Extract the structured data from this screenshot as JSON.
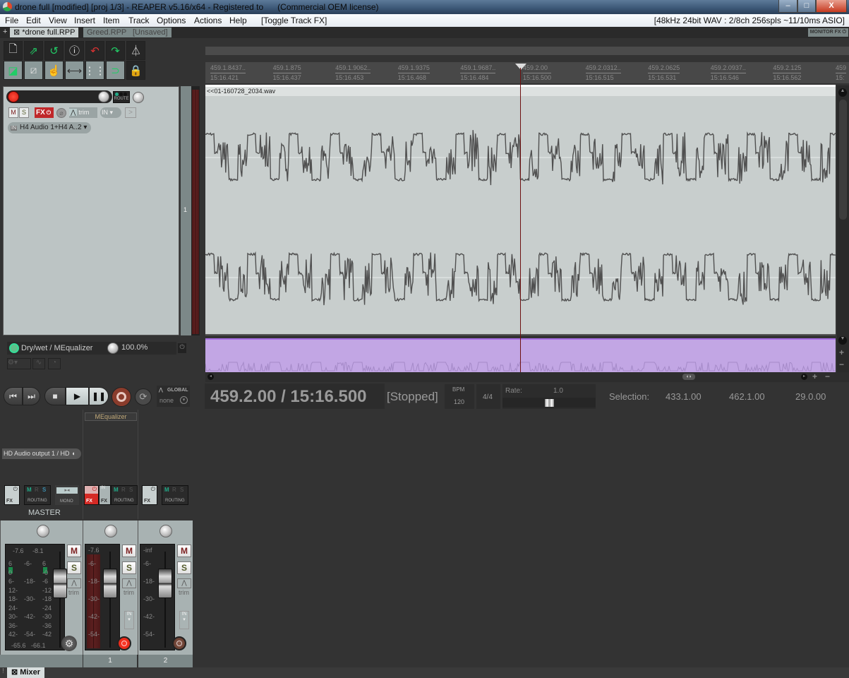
{
  "window": {
    "title": "drone full [modified] [proj 1/3] - REAPER v5.16/x64 - Registered to      (Commercial OEM license)",
    "minimize_label": "–",
    "maximize_label": "□",
    "close_label": "X"
  },
  "menu": {
    "items": [
      "File",
      "Edit",
      "View",
      "Insert",
      "Item",
      "Track",
      "Options",
      "Actions",
      "Help",
      "[Toggle Track FX]"
    ],
    "status": "[48kHz 24bit WAV : 2/8ch 256spls ~11/10ms ASIO]"
  },
  "project_tabs": {
    "add_label": "+",
    "tabs": [
      {
        "label": "⊠ *drone full.RPP",
        "active": true
      },
      {
        "label": "Greed.RPP",
        "active": false
      },
      {
        "label": "[Unsaved]",
        "active": false
      }
    ],
    "monitor_fx_label": "MONITOR FX ⏻"
  },
  "toolbar": {
    "buttons": [
      {
        "icon": "new-project-icon",
        "glyph": "🗋"
      },
      {
        "icon": "save-project-icon",
        "glyph": "⇗"
      },
      {
        "icon": "revert-project-icon",
        "glyph": "↺"
      },
      {
        "icon": "project-info-icon",
        "glyph": "ⓘ"
      },
      {
        "icon": "undo-icon",
        "glyph": "↶"
      },
      {
        "icon": "redo-icon",
        "glyph": "↷"
      },
      {
        "icon": "metronome-icon",
        "glyph": "⏃"
      },
      {
        "icon": "snap-icon",
        "glyph": "◪"
      },
      {
        "icon": "ripple-edit-icon",
        "glyph": "⧄"
      },
      {
        "icon": "grouping-icon",
        "glyph": "☝"
      },
      {
        "icon": "envelope-points-icon",
        "glyph": "⟷"
      },
      {
        "icon": "grid-icon",
        "glyph": "⋮⋮"
      },
      {
        "icon": "loop-icon",
        "glyph": "⊃"
      },
      {
        "icon": "lock-icon",
        "glyph": "🔒"
      }
    ]
  },
  "track": {
    "number": "1",
    "mute_label": "M",
    "solo_label": "S",
    "fx_label": "FX",
    "route_label": "ROUTE",
    "trim_label": "trim",
    "in_label": "IN",
    "input_label": "H4 Audio 1+H4 A..2",
    "item_name": "<<01-160728_2034.wav"
  },
  "envelope": {
    "name": "Dry/wet / MEqualizer",
    "value": "100.0%"
  },
  "ruler": {
    "ticks": [
      {
        "beats": "459.1.8437..",
        "time": "15:16.421"
      },
      {
        "beats": "459.1.875",
        "time": "15:16.437"
      },
      {
        "beats": "459.1.9062..",
        "time": "15:16.453"
      },
      {
        "beats": "459.1.9375",
        "time": "15:16.468"
      },
      {
        "beats": "459.1.9687..",
        "time": "15:16.484"
      },
      {
        "beats": "459.2.00",
        "time": "15:16.500"
      },
      {
        "beats": "459.2.0312..",
        "time": "15:16.515"
      },
      {
        "beats": "459.2.0625",
        "time": "15:16.531"
      },
      {
        "beats": "459.2.0937..",
        "time": "15:16.546"
      },
      {
        "beats": "459.2.125",
        "time": "15:16.562"
      },
      {
        "beats": "459",
        "time": "15:"
      }
    ]
  },
  "transport": {
    "position": "459.2.00 / 15:16.500",
    "state": "[Stopped]",
    "bpm_label": "BPM",
    "bpm": "120",
    "time_signature": "4/4",
    "rate_label": "Rate:",
    "rate": "1.0",
    "global_label": "GLOBAL",
    "global_value": "none",
    "selection_label": "Selection:",
    "selection_start": "433.1.00",
    "selection_end": "462.1.00",
    "selection_length": "29.0.00"
  },
  "mixer": {
    "master": {
      "name": "MASTER",
      "output": "HD Audio output 1 / HD",
      "peak_l": "-7.6",
      "peak_r": "-8.1",
      "floor_l": "-65.6",
      "floor_r": "-66.1",
      "fx_label": "FX",
      "routing_label": "ROUTING",
      "mono_label": "MONO",
      "scale_left": [
        "6",
        "0",
        "6-",
        "12-",
        "18-",
        "24-",
        "30-",
        "36-",
        "42-"
      ],
      "scale_mid": [
        "-6-",
        "-18-",
        "-30-",
        "-42-",
        "-54-"
      ],
      "scale_right": [
        "6",
        "-0",
        "-6",
        "-12",
        "-18",
        "-24",
        "-30",
        "-36",
        "-42"
      ]
    },
    "tracks": [
      {
        "number": "1",
        "fx_name": "MEqualizer",
        "peak": "-7.6",
        "fx_label": "FX",
        "in_label": "IN",
        "routing_label": "ROUTING"
      },
      {
        "number": "2",
        "fx_name": "",
        "peak": "-inf",
        "fx_label": "FX",
        "routing_label": "ROUTING"
      }
    ],
    "scale": [
      "-6-",
      "-18-",
      "-30-",
      "-42-",
      "-54-"
    ],
    "mute_label": "M",
    "solo_label": "S",
    "trim_label": "trim",
    "in_label": "IN"
  },
  "bottom_tabs": {
    "mixer_label": "⊠ Mixer"
  }
}
